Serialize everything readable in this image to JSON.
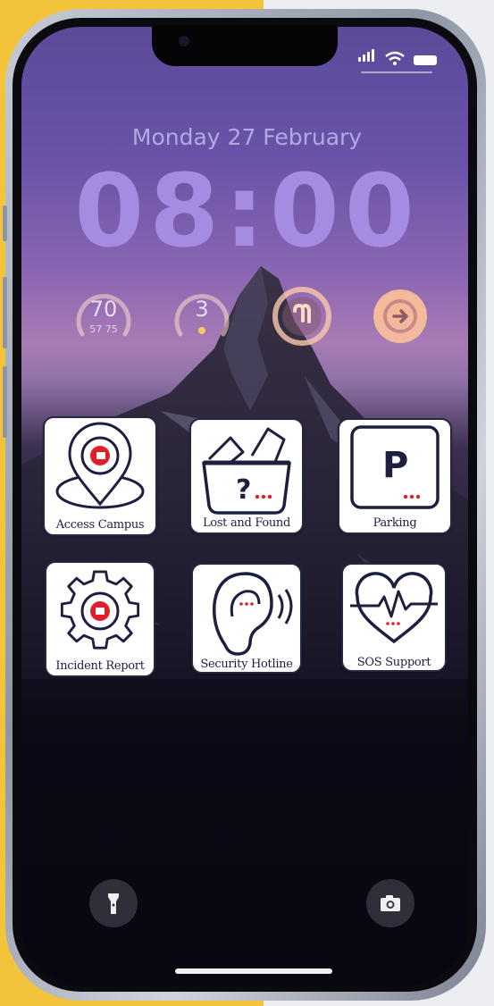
{
  "lockscreen": {
    "date": "Monday 27 February",
    "time": "08:00"
  },
  "widgets": {
    "temperature": {
      "current": "70",
      "low_high": "57 75"
    },
    "uv_index": {
      "value": "3"
    },
    "airpods": {
      "icon": "airpods-icon"
    },
    "next": {
      "icon": "arrow-right-icon"
    }
  },
  "tiles": [
    {
      "label": "Access Campus",
      "icon": "location-pin-icon"
    },
    {
      "label": "Lost and Found",
      "icon": "lost-found-box-icon"
    },
    {
      "label": "Parking",
      "icon": "parking-icon"
    },
    {
      "label": "Incident Report",
      "icon": "gear-alert-icon"
    },
    {
      "label": "Security Hotline",
      "icon": "ear-hotline-icon"
    },
    {
      "label": "SOS Support",
      "icon": "heart-pulse-icon"
    }
  ],
  "parking_letter": "P",
  "lost_found_mark": "?",
  "shortcuts": {
    "left": "flashlight-icon",
    "right": "camera-icon"
  },
  "colors": {
    "accent_red": "#e21f26",
    "tile_navy": "#1c1f3d",
    "frame_yellow": "#f3c43a"
  }
}
